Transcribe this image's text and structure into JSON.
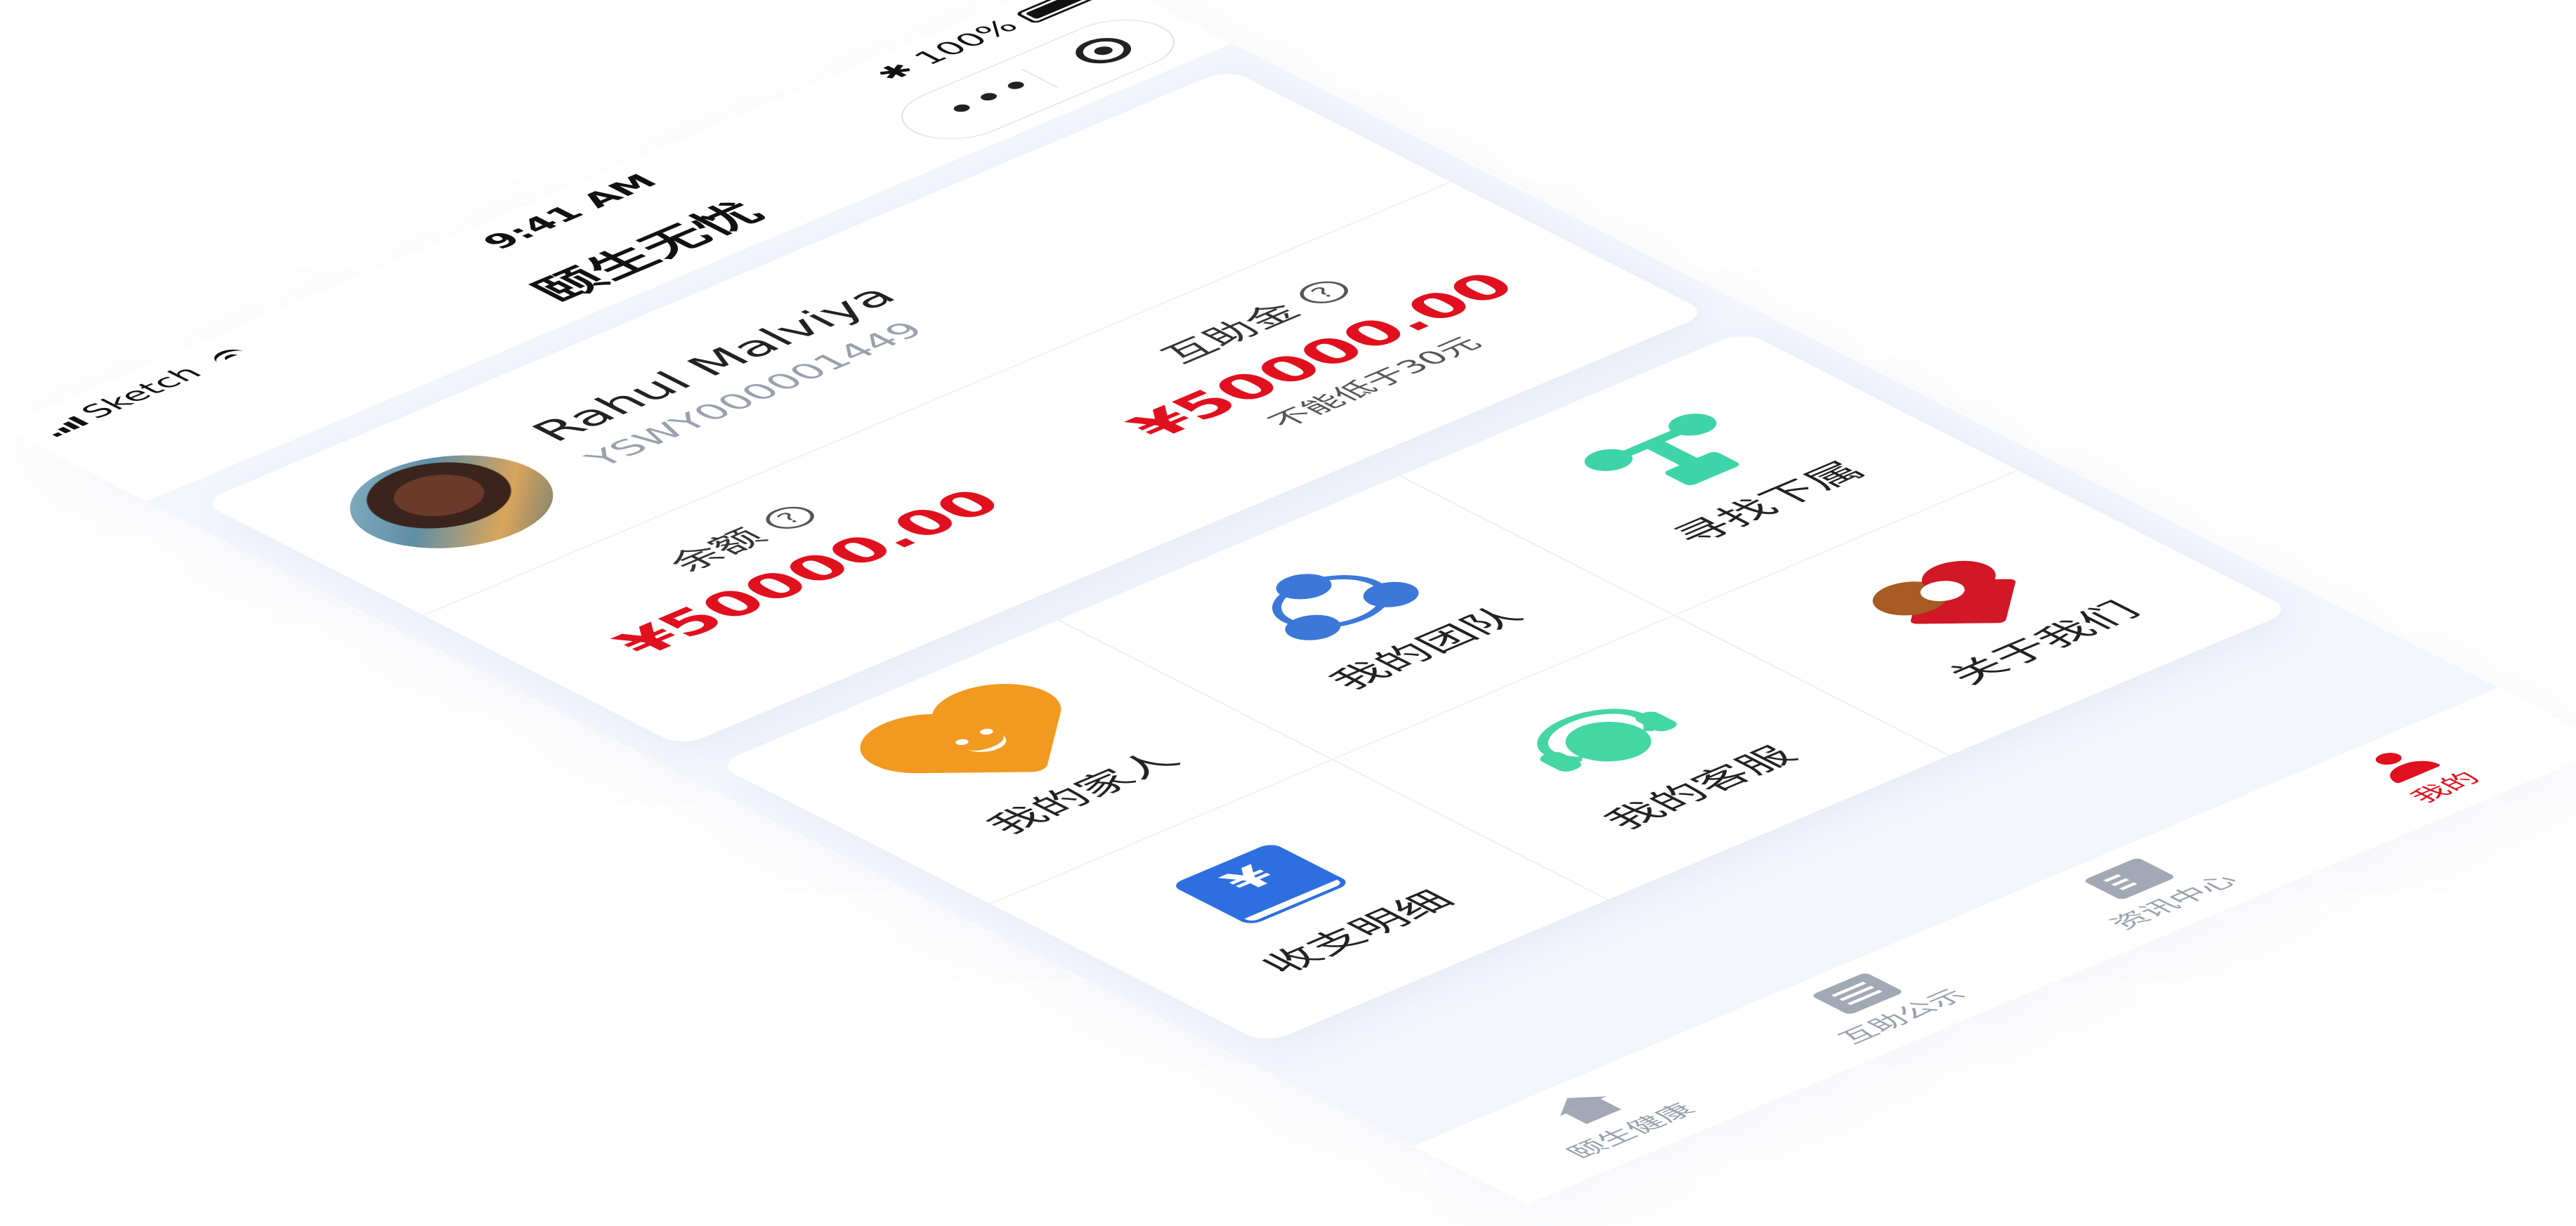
{
  "status_bar": {
    "carrier": "Sketch",
    "time": "9:41 AM",
    "battery": "100%",
    "battery_level": 1.0
  },
  "navbar": {
    "title": "颐生无忧",
    "more_glyph": "•••",
    "icons": [
      "more-dots-icon",
      "target-circle-icon"
    ]
  },
  "profile": {
    "name": "Rahul Malviya",
    "member_id": "YSWY000001449",
    "balance": {
      "label": "余额",
      "amount": "¥50000.00"
    },
    "mutual_fund": {
      "label": "互助金",
      "amount": "¥50000.00",
      "note": "不能低于30元"
    },
    "help_glyph": "?"
  },
  "menu": {
    "items": [
      {
        "label": "我的家人",
        "icon": "heart-smile-icon"
      },
      {
        "label": "我的团队",
        "icon": "team-circles-icon"
      },
      {
        "label": "寻找下属",
        "icon": "org-tree-icon"
      },
      {
        "label": "收支明细",
        "icon": "finance-book-icon"
      },
      {
        "label": "我的客服",
        "icon": "headset-icon"
      },
      {
        "label": "关于我们",
        "icon": "heart-logo-icon"
      }
    ],
    "yen_glyph": "¥"
  },
  "tabbar": {
    "items": [
      {
        "label": "颐生健康",
        "icon": "home-icon",
        "active": false
      },
      {
        "label": "互助公示",
        "icon": "list-icon",
        "active": false
      },
      {
        "label": "资讯中心",
        "icon": "news-icon",
        "active": false
      },
      {
        "label": "我的",
        "icon": "user-icon",
        "active": true
      }
    ]
  },
  "colors": {
    "accent_red": "#e0101e",
    "page_background": "#f3f6fd",
    "orange": "#f29a1f",
    "blue": "#3b78d8",
    "green": "#3fd4a8"
  }
}
